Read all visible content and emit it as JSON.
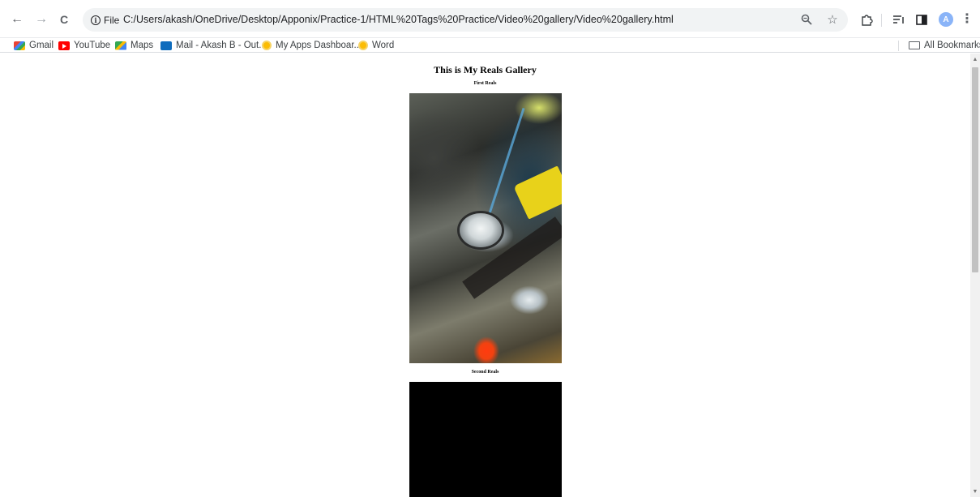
{
  "browser": {
    "back_glyph": "←",
    "forward_glyph": "→",
    "reload_glyph": "C",
    "site_chip_label": "File",
    "url": "C:/Users/akash/OneDrive/Desktop/Apponix/Practice-1/HTML%20Tags%20Practice/Video%20gallery/Video%20gallery.html",
    "avatar_letter": "A",
    "menu_glyph": "⋮"
  },
  "bookmarks": {
    "items": [
      {
        "label": "Gmail",
        "icon": "gmail-icon"
      },
      {
        "label": "YouTube",
        "icon": "youtube-icon"
      },
      {
        "label": "Maps",
        "icon": "maps-icon"
      },
      {
        "label": "Mail - Akash B - Out...",
        "icon": "outlook-icon"
      },
      {
        "label": "My Apps Dashboar...",
        "icon": "apps-dashboard-icon"
      },
      {
        "label": "Word",
        "icon": "word-icon"
      }
    ],
    "all_bookmarks_label": "All Bookmarks"
  },
  "page": {
    "title": "This is My Reals Gallery",
    "reels": [
      {
        "caption": "First Reals"
      },
      {
        "caption": "Second Reals"
      }
    ]
  }
}
